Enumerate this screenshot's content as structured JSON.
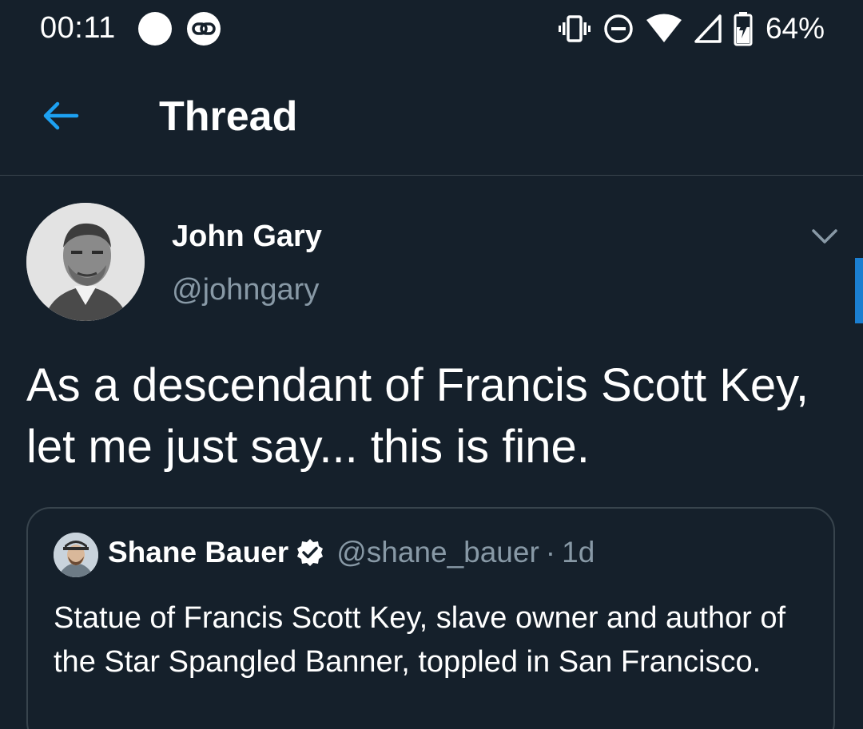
{
  "status_bar": {
    "time": "00:11",
    "battery_percent": "64%",
    "icons": [
      "notification-dot-icon",
      "link-icon",
      "vibrate-icon",
      "do-not-disturb-icon",
      "wifi-icon",
      "signal-icon",
      "battery-charging-icon"
    ]
  },
  "header": {
    "back_icon": "back-arrow-icon",
    "title": "Thread"
  },
  "tweet": {
    "author_name": "John Gary",
    "author_handle": "@johngary",
    "menu_icon": "chevron-down-icon",
    "text": "As a descendant of Francis Scott Key, let me just say... this is fine."
  },
  "quoted_tweet": {
    "author_name": "Shane Bauer",
    "verified_icon": "verified-badge-icon",
    "author_handle": "@shane_bauer",
    "separator": "·",
    "time": "1d",
    "text": "Statue of Francis Scott Key, slave owner and author of the Star Spangled Banner, toppled in San Francisco."
  },
  "colors": {
    "background": "#15202b",
    "accent": "#1da1f2",
    "secondary_text": "#8899a6",
    "divider": "#38444d"
  }
}
